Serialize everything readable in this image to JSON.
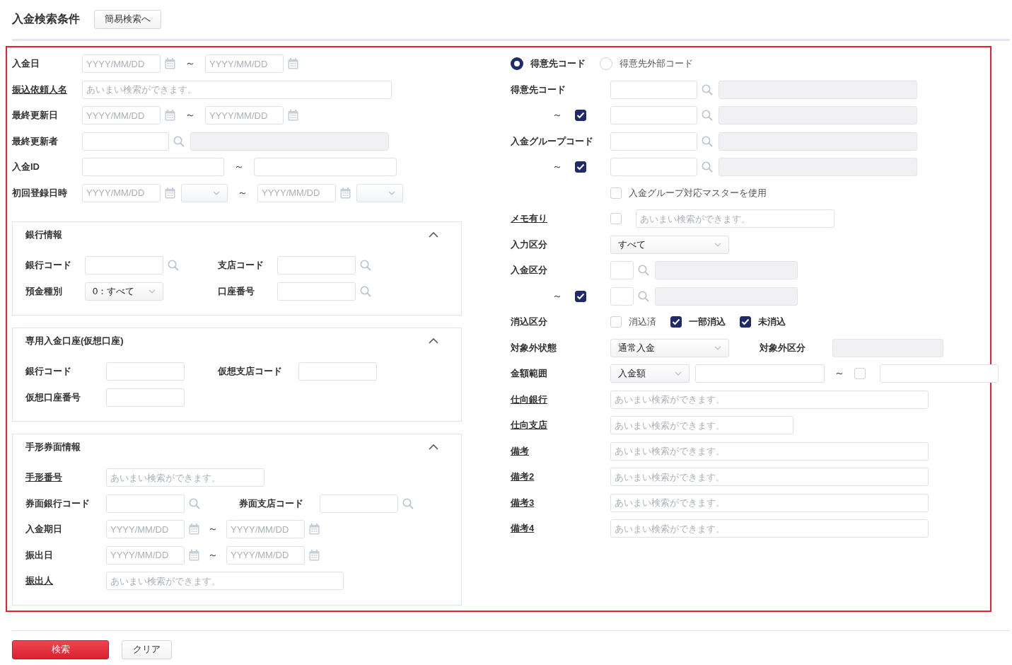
{
  "header": {
    "title": "入金検索条件",
    "button": "簡易検索へ"
  },
  "left": {
    "rows": [
      {
        "label": "入金日",
        "link": false,
        "fields": [
          {
            "kind": "date",
            "placeholder": "YYYY/MM/DD"
          },
          {
            "kind": "tilde",
            "text": "～"
          },
          {
            "kind": "date",
            "placeholder": "YYYY/MM/DD"
          }
        ]
      },
      {
        "label": "振込依頼人名",
        "link": true,
        "fields": [
          {
            "kind": "text",
            "placeholder": "あいまい検索ができます。"
          }
        ]
      },
      {
        "label": "最終更新日",
        "link": false,
        "fields": [
          {
            "kind": "date",
            "placeholder": "YYYY/MM/DD"
          },
          {
            "kind": "tilde",
            "text": "～"
          },
          {
            "kind": "date",
            "placeholder": "YYYY/MM/DD"
          }
        ]
      },
      {
        "label": "最終更新者",
        "link": false,
        "fields": [
          {
            "kind": "lookup"
          },
          {
            "kind": "display"
          }
        ]
      },
      {
        "label": "入金ID",
        "link": false,
        "fields": [
          {
            "kind": "text"
          },
          {
            "kind": "tilde",
            "text": "～"
          },
          {
            "kind": "text"
          }
        ]
      },
      {
        "label": "初回登録日時",
        "link": false,
        "fields": [
          {
            "kind": "date",
            "placeholder": "YYYY/MM/DD"
          },
          {
            "kind": "select"
          },
          {
            "kind": "tilde",
            "text": "～"
          },
          {
            "kind": "date",
            "placeholder": "YYYY/MM/DD"
          },
          {
            "kind": "select"
          }
        ]
      }
    ],
    "sections": [
      {
        "title": "銀行情報",
        "expanded": true,
        "rows": [
          {
            "pairs": [
              {
                "label": "銀行コード",
                "link": false,
                "fields": [
                  {
                    "kind": "lookup"
                  }
                ]
              },
              {
                "label": "支店コード",
                "link": false,
                "fields": [
                  {
                    "kind": "lookup"
                  }
                ]
              }
            ]
          },
          {
            "pairs": [
              {
                "label": "預金種別",
                "link": false,
                "fields": [
                  {
                    "kind": "select",
                    "value": "0：すべて"
                  }
                ]
              },
              {
                "label": "口座番号",
                "link": false,
                "fields": [
                  {
                    "kind": "lookup"
                  }
                ]
              }
            ]
          }
        ]
      },
      {
        "title": "専用入金口座(仮想口座)",
        "expanded": true,
        "rows": [
          {
            "pairs": [
              {
                "label": "銀行コード",
                "link": false,
                "fields": [
                  {
                    "kind": "text"
                  }
                ]
              },
              {
                "label": "仮想支店コード",
                "link": false,
                "fields": [
                  {
                    "kind": "text"
                  }
                ]
              }
            ]
          },
          {
            "pairs": [
              {
                "label": "仮想口座番号",
                "link": false,
                "fields": [
                  {
                    "kind": "text"
                  }
                ]
              }
            ]
          }
        ]
      },
      {
        "title": "手形券面情報",
        "expanded": true,
        "rows": [
          {
            "pairs": [
              {
                "label": "手形番号",
                "link": true,
                "fields": [
                  {
                    "kind": "text",
                    "placeholder": "あいまい検索ができます。"
                  }
                ]
              }
            ]
          },
          {
            "pairs": [
              {
                "label": "券面銀行コード",
                "link": false,
                "fields": [
                  {
                    "kind": "lookup"
                  }
                ]
              },
              {
                "label": "券面支店コード",
                "link": false,
                "fields": [
                  {
                    "kind": "lookup"
                  }
                ]
              }
            ]
          },
          {
            "pairs": [
              {
                "label": "入金期日",
                "link": false,
                "fields": [
                  {
                    "kind": "date",
                    "placeholder": "YYYY/MM/DD"
                  },
                  {
                    "kind": "tilde",
                    "text": "～"
                  },
                  {
                    "kind": "date",
                    "placeholder": "YYYY/MM/DD"
                  }
                ]
              }
            ]
          },
          {
            "pairs": [
              {
                "label": "振出日",
                "link": false,
                "fields": [
                  {
                    "kind": "date",
                    "placeholder": "YYYY/MM/DD"
                  },
                  {
                    "kind": "tilde",
                    "text": "～"
                  },
                  {
                    "kind": "date",
                    "placeholder": "YYYY/MM/DD"
                  }
                ]
              }
            ]
          },
          {
            "pairs": [
              {
                "label": "振出人",
                "link": true,
                "fields": [
                  {
                    "kind": "text",
                    "placeholder": "あいまい検索ができます。"
                  }
                ]
              }
            ]
          }
        ]
      }
    ]
  },
  "right": {
    "radios": [
      {
        "label": "得意先コード",
        "selected": true
      },
      {
        "label": "得意先外部コード",
        "selected": false
      }
    ],
    "rows": [
      {
        "label": "得意先コード",
        "link": false,
        "fields": [
          {
            "kind": "lookup"
          },
          {
            "kind": "display"
          }
        ]
      },
      {
        "lead": [
          {
            "kind": "tilde",
            "text": "～"
          },
          {
            "kind": "checkbox",
            "checked": true
          }
        ],
        "fields": [
          {
            "kind": "lookup"
          },
          {
            "kind": "display"
          }
        ]
      },
      {
        "label": "入金グループコード",
        "link": false,
        "fields": [
          {
            "kind": "lookup"
          },
          {
            "kind": "display"
          }
        ]
      },
      {
        "lead": [
          {
            "kind": "tilde",
            "text": "～"
          },
          {
            "kind": "checkbox",
            "checked": true
          }
        ],
        "fields": [
          {
            "kind": "lookup"
          },
          {
            "kind": "display"
          }
        ]
      },
      {
        "fields": [
          {
            "kind": "checkbox",
            "checked": false,
            "label": "入金グループ対応マスターを使用"
          }
        ]
      },
      {
        "label": "メモ有り",
        "link": true,
        "fields": [
          {
            "kind": "checkbox",
            "checked": false
          },
          {
            "kind": "text",
            "placeholder": "あいまい検索ができます。"
          }
        ]
      },
      {
        "label": "入力区分",
        "link": false,
        "fields": [
          {
            "kind": "select",
            "value": "すべて"
          }
        ]
      },
      {
        "label": "入金区分",
        "link": false,
        "fields": [
          {
            "kind": "lookup"
          },
          {
            "kind": "display"
          }
        ]
      },
      {
        "lead": [
          {
            "kind": "tilde",
            "text": "～"
          },
          {
            "kind": "checkbox",
            "checked": true
          }
        ],
        "fields": [
          {
            "kind": "lookup"
          },
          {
            "kind": "display"
          }
        ]
      },
      {
        "label": "消込区分",
        "link": false,
        "fields": [
          {
            "kind": "checkbox",
            "checked": false,
            "label": "消込済"
          },
          {
            "kind": "checkbox",
            "checked": true,
            "label": "一部消込"
          },
          {
            "kind": "checkbox",
            "checked": true,
            "label": "未消込"
          }
        ]
      },
      {
        "label": "対象外状態",
        "link": false,
        "fields": [
          {
            "kind": "select",
            "value": "通常入金"
          },
          {
            "kind": "label",
            "text": "対象外区分"
          },
          {
            "kind": "display"
          }
        ]
      },
      {
        "label": "金額範囲",
        "link": false,
        "fields": [
          {
            "kind": "select",
            "value": "入金額"
          },
          {
            "kind": "text"
          },
          {
            "kind": "tilde",
            "text": "～"
          },
          {
            "kind": "checkbox",
            "checked": false
          },
          {
            "kind": "text"
          }
        ]
      },
      {
        "label": "仕向銀行",
        "link": true,
        "fields": [
          {
            "kind": "text",
            "placeholder": "あいまい検索ができます。"
          }
        ]
      },
      {
        "label": "仕向支店",
        "link": true,
        "fields": [
          {
            "kind": "text",
            "placeholder": "あいまい検索ができます。"
          }
        ]
      },
      {
        "label": "備考",
        "link": true,
        "fields": [
          {
            "kind": "text",
            "placeholder": "あいまい検索ができます。"
          }
        ]
      },
      {
        "label": "備考2",
        "link": true,
        "fields": [
          {
            "kind": "text",
            "placeholder": "あいまい検索ができます。"
          }
        ]
      },
      {
        "label": "備考3",
        "link": true,
        "fields": [
          {
            "kind": "text",
            "placeholder": "あいまい検索ができます。"
          }
        ]
      },
      {
        "label": "備考4",
        "link": true,
        "fields": [
          {
            "kind": "text",
            "placeholder": "あいまい検索ができます。"
          }
        ]
      }
    ]
  },
  "footer": {
    "buttons": [
      {
        "label": "検索",
        "kind": "primary"
      },
      {
        "label": "クリア",
        "kind": "secondary"
      }
    ]
  }
}
